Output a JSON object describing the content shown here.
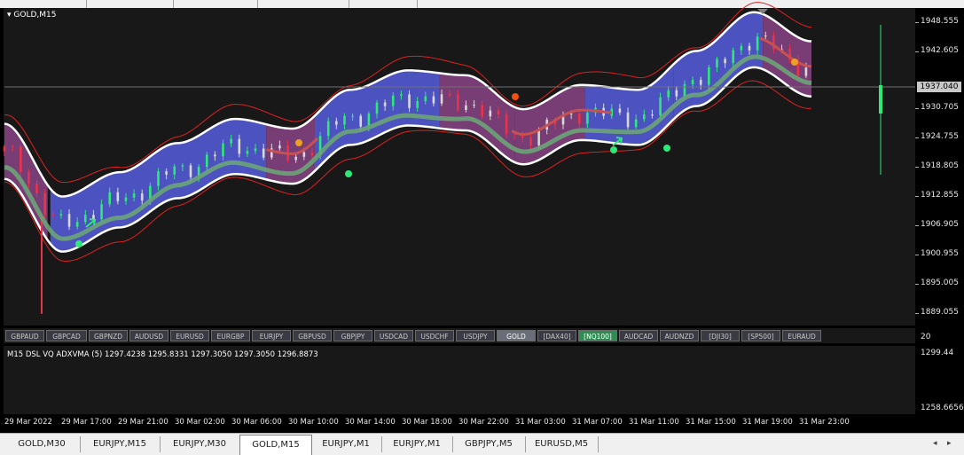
{
  "window": {
    "title": "GOLD,M15"
  },
  "price_axis": {
    "ticks": [
      "1948.555",
      "1942.605",
      "1937.040",
      "1930.705",
      "1924.755",
      "1918.805",
      "1912.855",
      "1906.905",
      "1900.955",
      "1895.005",
      "1889.055"
    ],
    "current_price": "1937.040"
  },
  "symbols": {
    "items": [
      "GBPAUD",
      "GBPCAD",
      "GBPNZD",
      "AUDUSD",
      "EURUSD",
      "EURGBP",
      "EURJPY",
      "GBPUSD",
      "GBPJPY",
      "USDCAD",
      "USDCHF",
      "USDJPY",
      "GOLD",
      "[DAX40]",
      "[NQ100]",
      "AUDCAD",
      "AUDNZD",
      "[DJI30]",
      "[SP500]",
      "EURAUD"
    ],
    "active": "GOLD",
    "highlighted": "[NQ100]"
  },
  "indicator": {
    "title": "M15 DSL  VQ  ADXVMA (5)  1297.4238 1295.8331 1297.3050 1297.3050 1296.8873",
    "axis_top": "20",
    "axis_max": "1299.44",
    "axis_min": "1258.6656"
  },
  "time_axis": {
    "labels": [
      "29 Mar 2022",
      "29 Mar 17:00",
      "29 Mar 21:00",
      "30 Mar 02:00",
      "30 Mar 06:00",
      "30 Mar 10:00",
      "30 Mar 14:00",
      "30 Mar 18:00",
      "30 Mar 22:00",
      "31 Mar 03:00",
      "31 Mar 07:00",
      "31 Mar 11:00",
      "31 Mar 15:00",
      "31 Mar 19:00",
      "31 Mar 23:00"
    ]
  },
  "tabs": {
    "items": [
      "GOLD,M30",
      "EURJPY,M15",
      "EURJPY,M30",
      "GOLD,M15",
      "EURJPY,M1",
      "EURJPY,M1",
      "GBPJPY,M5",
      "EURUSD,M5"
    ],
    "active": "GOLD,M15"
  },
  "colors": {
    "bull": "#2ee87a",
    "bear": "#e8334a",
    "neutral": "#d8d8d8",
    "band_blue": "#4f55c8",
    "band_purple": "#7e3f7a"
  },
  "chart_data": {
    "type": "candlestick",
    "title": "GOLD,M15",
    "ylim": [
      1888,
      1952
    ],
    "x": [
      "29 Mar 2022",
      "29 Mar 17:00",
      "29 Mar 21:00",
      "30 Mar 02:00",
      "30 Mar 06:00",
      "30 Mar 10:00",
      "30 Mar 14:00",
      "30 Mar 18:00",
      "30 Mar 22:00",
      "31 Mar 03:00",
      "31 Mar 07:00",
      "31 Mar 11:00",
      "31 Mar 15:00",
      "31 Mar 19:00",
      "31 Mar 23:00"
    ],
    "series": [
      {
        "values": [
          1923,
          1908,
          1913,
          1919,
          1924,
          1922,
          1930,
          1934,
          1933,
          1926,
          1931,
          1930,
          1938,
          1946,
          1940
        ]
      }
    ]
  }
}
